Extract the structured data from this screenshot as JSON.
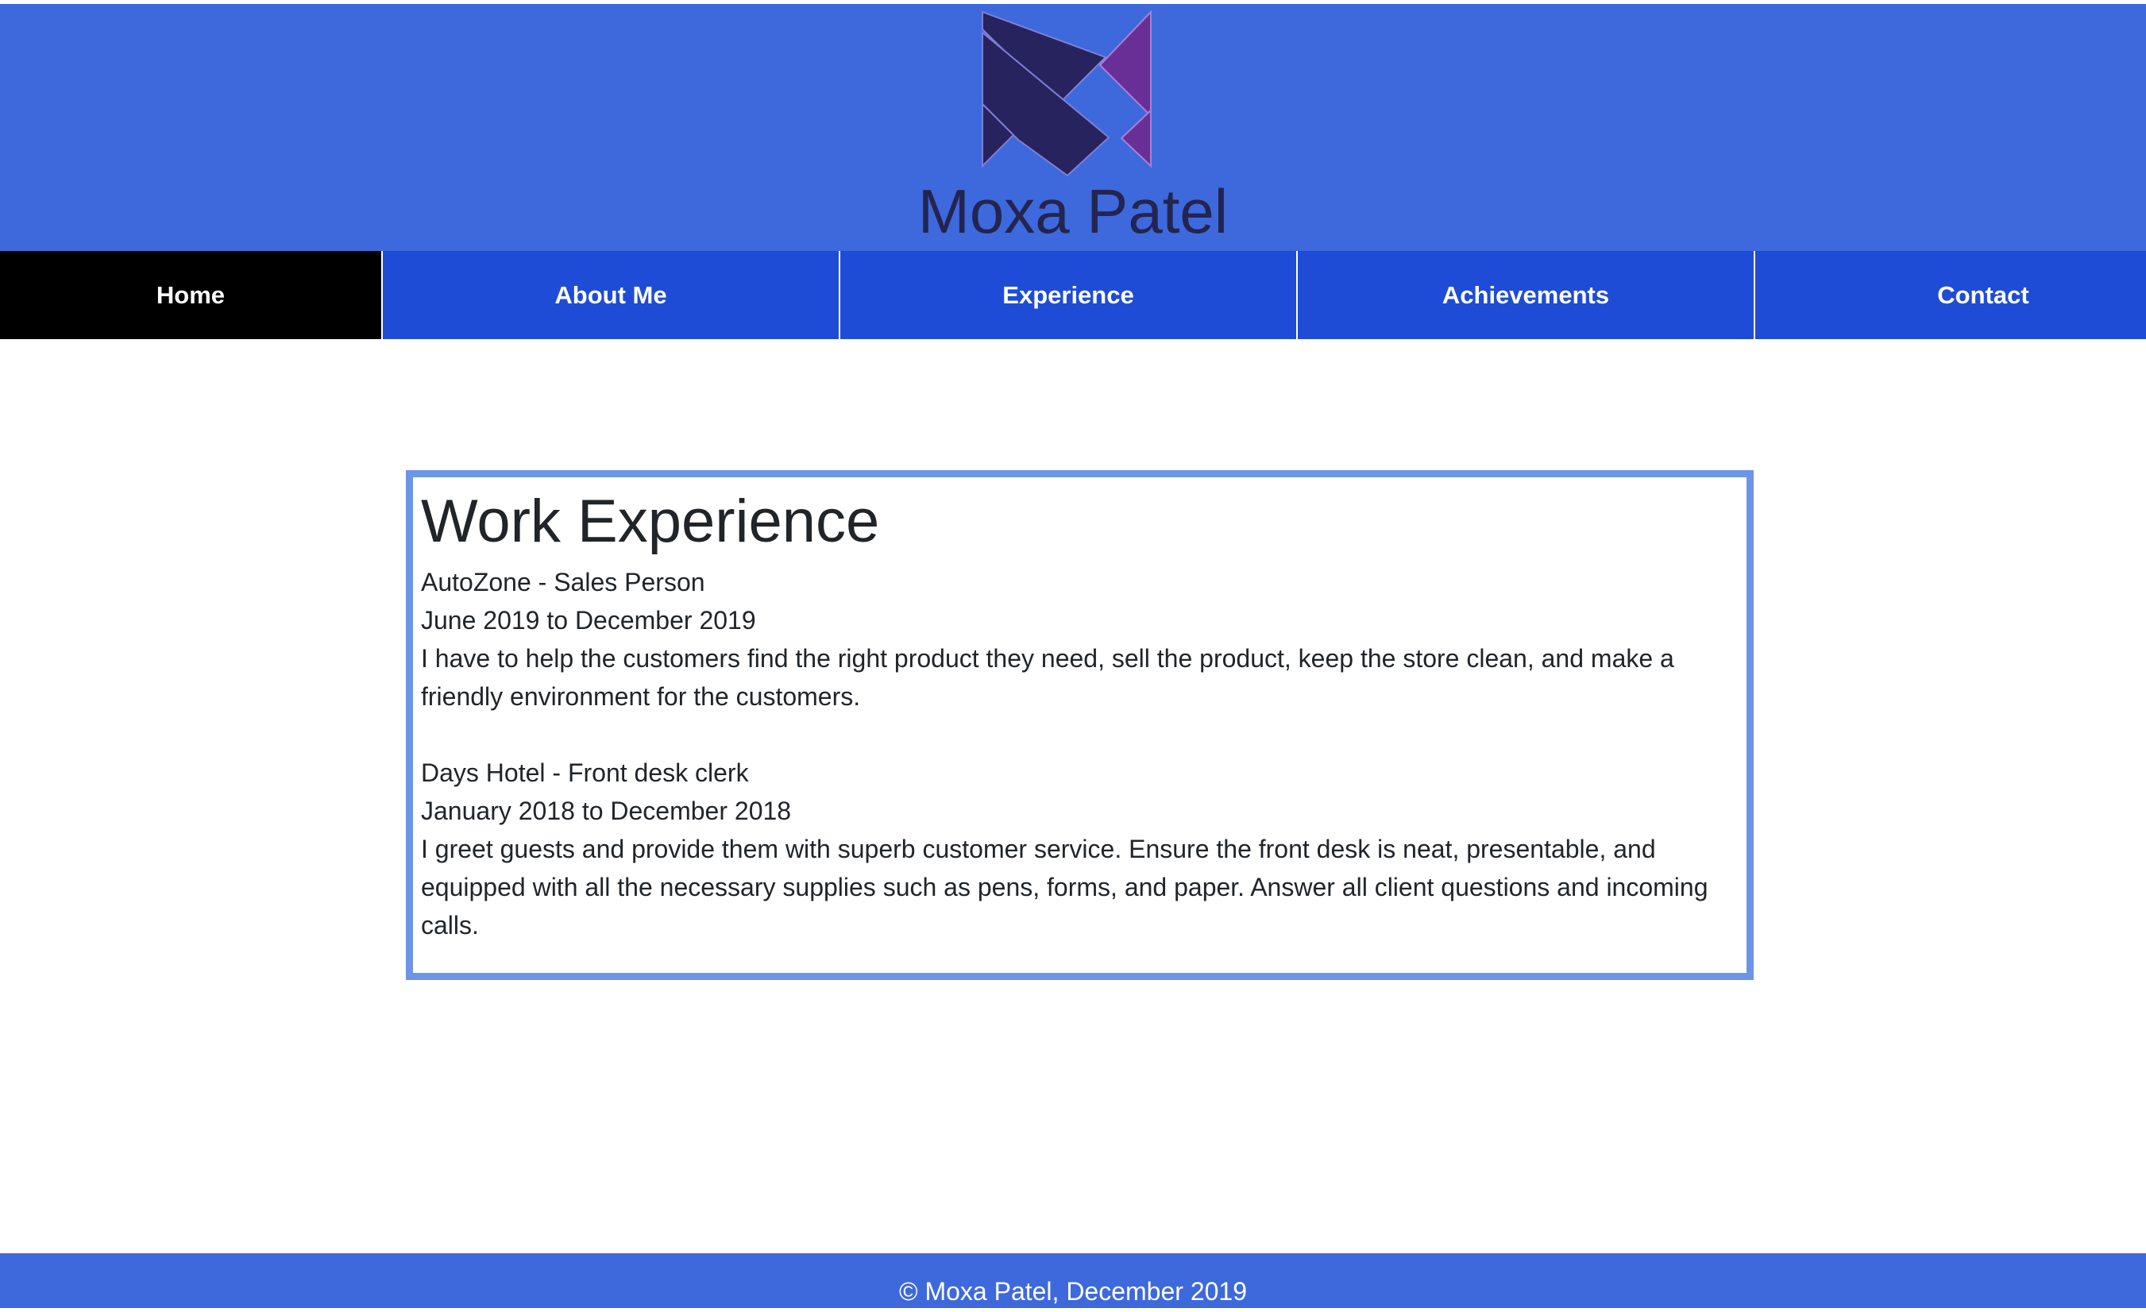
{
  "header": {
    "title": "Moxa Patel",
    "logo_colors": {
      "dark": "#27235f",
      "accent": "#6a2f97",
      "background": "#3d69dc"
    }
  },
  "nav": {
    "items": [
      {
        "label": "Home"
      },
      {
        "label": "About Me"
      },
      {
        "label": "Experience"
      },
      {
        "label": "Achievements"
      },
      {
        "label": "Contact"
      }
    ],
    "active_item": "Home",
    "colors": {
      "background": "#1e4cd6",
      "active_background": "#000000",
      "text": "#ffffff"
    }
  },
  "main": {
    "section_title": "Work Experience",
    "jobs": [
      {
        "title": "AutoZone - Sales Person",
        "dates": "June 2019 to December 2019",
        "description": "I have to help the customers find the right product they need, sell the product, keep the store clean, and make a friendly environment for the customers."
      },
      {
        "title": "Days Hotel - Front desk clerk",
        "dates": "January 2018 to December 2018",
        "description": "I greet guests and provide them with superb customer service. Ensure the front desk is neat, presentable, and equipped with all the necessary supplies such as pens, forms, and paper. Answer all client questions and incoming calls."
      }
    ],
    "border_color": "#6c95e6"
  },
  "footer": {
    "text": "© Moxa Patel, December 2019"
  }
}
